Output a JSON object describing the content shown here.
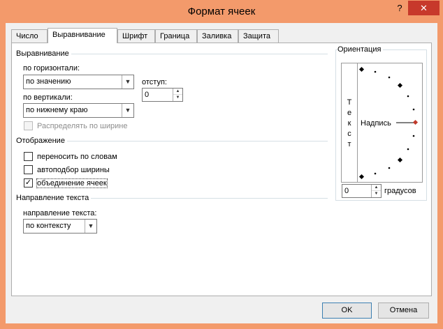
{
  "window": {
    "title": "Формат ячеек",
    "help_glyph": "?",
    "close_glyph": "✕"
  },
  "tabs": [
    {
      "label": "Число"
    },
    {
      "label": "Выравнивание"
    },
    {
      "label": "Шрифт"
    },
    {
      "label": "Граница"
    },
    {
      "label": "Заливка"
    },
    {
      "label": "Защита"
    }
  ],
  "alignment": {
    "group_label": "Выравнивание",
    "horizontal_label": "по горизонтали:",
    "horizontal_value": "по значению",
    "indent_label": "отступ:",
    "indent_value": "0",
    "vertical_label": "по вертикали:",
    "vertical_value": "по нижнему краю",
    "distribute_label": "Распределять по ширине"
  },
  "display": {
    "group_label": "Отображение",
    "wrap_text_label": "переносить по словам",
    "wrap_text_checked": false,
    "shrink_fit_label": "автоподбор ширины",
    "shrink_fit_checked": false,
    "merge_cells_label": "объединение ячеек",
    "merge_cells_checked": true
  },
  "direction": {
    "group_label": "Направление текста",
    "text_direction_label": "направление текста:",
    "text_direction_value": "по контексту"
  },
  "orientation": {
    "group_label": "Ориентация",
    "vertical_letters": [
      "Т",
      "е",
      "к",
      "с",
      "т"
    ],
    "dial_label": "Надпись",
    "degrees_value": "0",
    "degrees_label": "градусов",
    "indicator_color": "#c0392b"
  },
  "buttons": {
    "ok": "OK",
    "cancel": "Отмена"
  },
  "glyphs": {
    "combo_arrow": "▼",
    "spin_up": "▲",
    "spin_down": "▼",
    "check": "✓"
  }
}
